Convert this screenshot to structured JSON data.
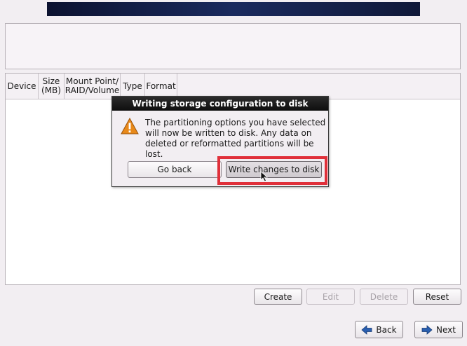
{
  "table": {
    "columns": [
      "Device",
      "Size\n(MB)",
      "Mount Point/\nRAID/Volume",
      "Type",
      "Format"
    ]
  },
  "dialog": {
    "title": "Writing storage configuration to disk",
    "message": "The partitioning options you have selected will now be written to disk.  Any data on deleted or reformatted partitions will be lost.",
    "go_back_label": "Go back",
    "write_label": "Write changes to disk",
    "icon": "warning-icon"
  },
  "actions": {
    "create": "Create",
    "edit": "Edit",
    "delete": "Delete",
    "reset": "Reset"
  },
  "nav": {
    "back": "Back",
    "next": "Next"
  },
  "colors": {
    "highlight": "#e0303a",
    "nav_arrow": "#2a5fb0",
    "warning": "#e8891a"
  }
}
